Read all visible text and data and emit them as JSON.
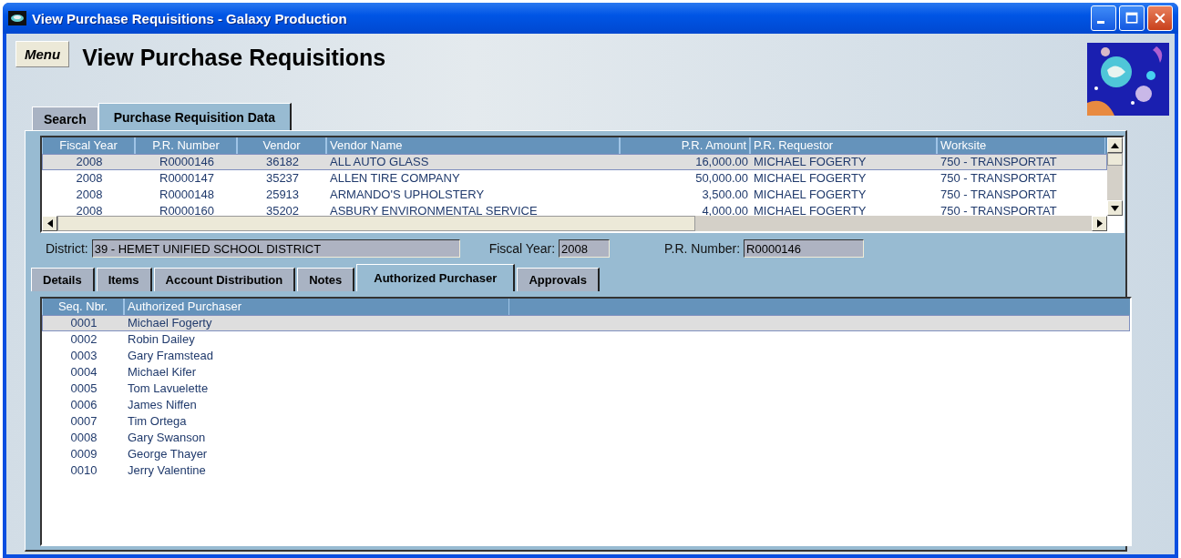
{
  "window": {
    "title": "View Purchase Requisitions - Galaxy Production"
  },
  "menu_button": {
    "label": "Menu"
  },
  "heading": "View Purchase Requisitions",
  "tabs": [
    {
      "label": "Search",
      "selected": false
    },
    {
      "label": "Purchase Requisition Data",
      "selected": true
    }
  ],
  "requisitions": {
    "columns": [
      "Fiscal Year",
      "P.R. Number",
      "Vendor",
      "Vendor Name",
      "P.R. Amount",
      "P.R. Requestor",
      "Worksite"
    ],
    "rows": [
      {
        "cells": [
          "2008",
          "R0000146",
          "36182",
          "ALL AUTO GLASS",
          "16,000.00",
          "MICHAEL FOGERTY",
          "750 - TRANSPORTAT"
        ],
        "selected": true
      },
      {
        "cells": [
          "2008",
          "R0000147",
          "35237",
          "ALLEN TIRE COMPANY",
          "50,000.00",
          "MICHAEL FOGERTY",
          "750 - TRANSPORTAT"
        ],
        "selected": false
      },
      {
        "cells": [
          "2008",
          "R0000148",
          "25913",
          "ARMANDO'S UPHOLSTERY",
          "3,500.00",
          "MICHAEL FOGERTY",
          "750 - TRANSPORTAT"
        ],
        "selected": false
      },
      {
        "cells": [
          "2008",
          "R0000160",
          "35202",
          "ASBURY ENVIRONMENTAL SERVICE",
          "4,000.00",
          "MICHAEL FOGERTY",
          "750 - TRANSPORTAT"
        ],
        "selected": false
      }
    ]
  },
  "fields": [
    {
      "label": "District:",
      "value": "39 - HEMET UNIFIED SCHOOL DISTRICT"
    },
    {
      "label": "Fiscal Year:",
      "value": "2008"
    },
    {
      "label": "P.R. Number:",
      "value": "R0000146"
    }
  ],
  "detail_tabs": [
    {
      "label": "Details",
      "selected": false
    },
    {
      "label": "Items",
      "selected": false
    },
    {
      "label": "Account Distribution",
      "selected": false
    },
    {
      "label": "Notes",
      "selected": false
    },
    {
      "label": "Authorized Purchaser",
      "selected": true
    },
    {
      "label": "Approvals",
      "selected": false
    }
  ],
  "purchasers": {
    "columns": [
      "Seq. Nbr.",
      "Authorized Purchaser"
    ],
    "rows": [
      {
        "cells": [
          "0001",
          "Michael Fogerty"
        ],
        "selected": true
      },
      {
        "cells": [
          "0002",
          "Robin Dailey"
        ],
        "selected": false
      },
      {
        "cells": [
          "0003",
          "Gary Framstead"
        ],
        "selected": false
      },
      {
        "cells": [
          "0004",
          "Michael Kifer"
        ],
        "selected": false
      },
      {
        "cells": [
          "0005",
          "Tom Lavuelette"
        ],
        "selected": false
      },
      {
        "cells": [
          "0006",
          "James Niffen"
        ],
        "selected": false
      },
      {
        "cells": [
          "0007",
          "Tim Ortega"
        ],
        "selected": false
      },
      {
        "cells": [
          "0008",
          "Gary Swanson"
        ],
        "selected": false
      },
      {
        "cells": [
          "0009",
          "George Thayer"
        ],
        "selected": false
      },
      {
        "cells": [
          "0010",
          "Jerry Valentine"
        ],
        "selected": false
      }
    ]
  }
}
